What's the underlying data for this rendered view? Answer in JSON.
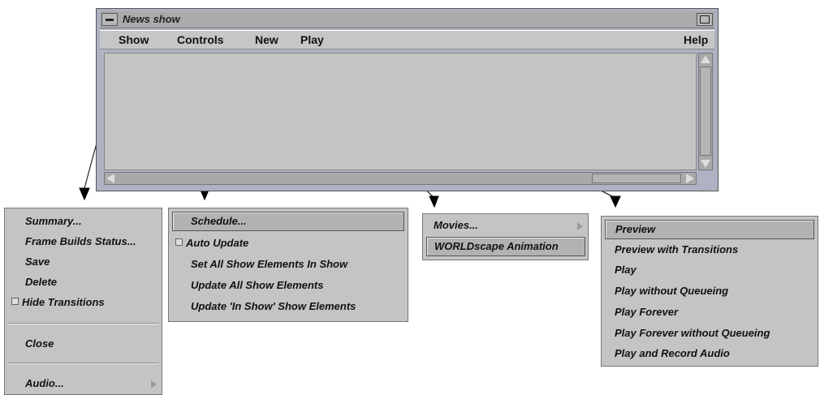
{
  "window": {
    "title": "News show"
  },
  "menubar": {
    "show": "Show",
    "controls": "Controls",
    "new": "New",
    "play": "Play",
    "help": "Help"
  },
  "show_menu": {
    "summary": "Summary...",
    "frame_builds_status": "Frame Builds Status...",
    "save": "Save",
    "delete": "Delete",
    "hide_transitions": "Hide Transitions",
    "close": "Close",
    "audio": "Audio..."
  },
  "controls_menu": {
    "schedule": "Schedule...",
    "auto_update": "Auto Update",
    "set_all": "Set All Show Elements In Show",
    "update_all": "Update All Show Elements",
    "update_in_show": "Update 'In Show' Show Elements"
  },
  "new_menu": {
    "movies": "Movies...",
    "worldscape": "WORLDscape Animation"
  },
  "play_menu": {
    "preview": "Preview",
    "preview_with_transitions": "Preview with Transitions",
    "play": "Play",
    "play_without_queueing": "Play without Queueing",
    "play_forever": "Play Forever",
    "play_forever_without_queueing": "Play Forever without Queueing",
    "play_and_record_audio": "Play and Record Audio"
  },
  "colors": {
    "window_bg": "#aeb2c3",
    "menu_bg": "#c4c4c4",
    "highlight": "#b2b2b2"
  }
}
